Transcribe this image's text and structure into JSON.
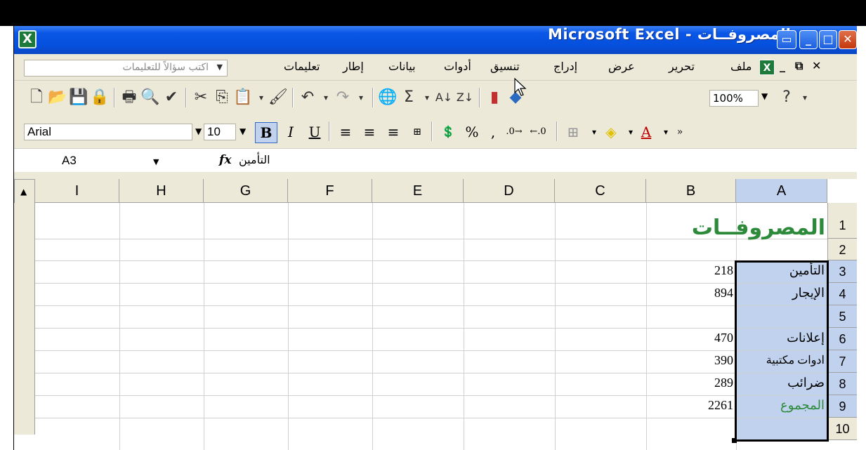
{
  "window": {
    "title": "Microsoft Excel - المصروفــات"
  },
  "menubar": {
    "help_placeholder": "اكتب سؤالاً للتعليمات",
    "items": [
      "ملف",
      "تحرير",
      "عرض",
      "إدراج",
      "تنسيق",
      "أدوات",
      "بيانات",
      "إطار",
      "تعليمات"
    ]
  },
  "toolbar": {
    "zoom": "100%"
  },
  "format_toolbar": {
    "font_name": "Arial",
    "font_size": "10"
  },
  "formula_bar": {
    "name_box": "A3",
    "content": "التأمين"
  },
  "sheet": {
    "columns": [
      "I",
      "H",
      "G",
      "F",
      "E",
      "D",
      "C",
      "B",
      "A"
    ],
    "rows": [
      "1",
      "2",
      "3",
      "4",
      "5",
      "6",
      "7",
      "8",
      "9",
      "10"
    ],
    "title": "المصروفــات",
    "entries": [
      {
        "row": "3",
        "label": "التأمين",
        "value": "218"
      },
      {
        "row": "4",
        "label": "الإيجار",
        "value": "894"
      },
      {
        "row": "6",
        "label": "إعلانات",
        "value": "470"
      },
      {
        "row": "7",
        "label": "ادوات مكتبية",
        "value": "390"
      },
      {
        "row": "8",
        "label": "ضرائب",
        "value": "289"
      },
      {
        "row": "9",
        "label": "المجموع",
        "value": "2261"
      }
    ]
  },
  "colors": {
    "title_bar": "#0550dc",
    "selection": "#c1d2ee",
    "title_green": "#2c8a3a"
  }
}
